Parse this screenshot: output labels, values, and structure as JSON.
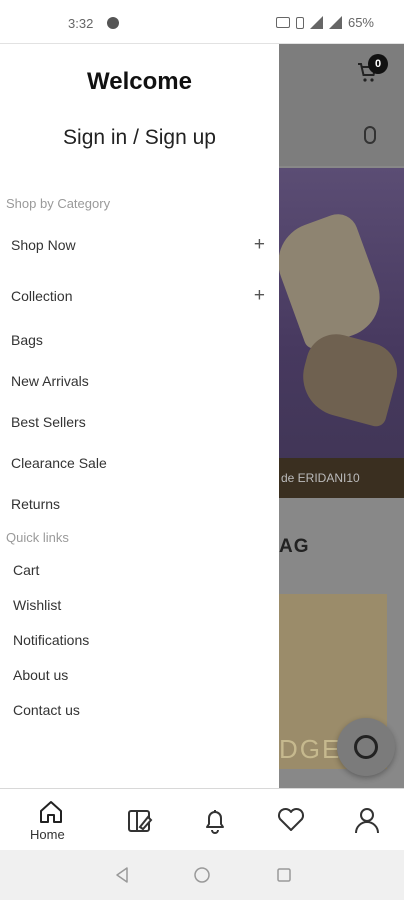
{
  "status_bar": {
    "time": "3:32",
    "battery": "65%"
  },
  "background_app": {
    "cart_count": "0",
    "hero_caption": "de ERIDANI10",
    "section_title": "AG",
    "product_text": "DGE"
  },
  "drawer": {
    "welcome": "Welcome",
    "signin": "Sign in / Sign up",
    "shop_section_label": "Shop by Category",
    "categories": [
      {
        "label": "Shop Now",
        "expandable": true
      },
      {
        "label": "Collection",
        "expandable": true
      },
      {
        "label": "Bags",
        "expandable": false
      },
      {
        "label": "New Arrivals",
        "expandable": false
      },
      {
        "label": "Best Sellers",
        "expandable": false
      },
      {
        "label": "Clearance Sale",
        "expandable": false
      },
      {
        "label": "Returns",
        "expandable": false
      }
    ],
    "expand_symbol": "+",
    "quick_section_label": "Quick links",
    "quick_links": [
      "Cart",
      "Wishlist",
      "Notifications",
      "About us",
      "Contact us"
    ]
  },
  "bottom_nav": {
    "home_label": "Home",
    "items": [
      "home-icon",
      "catalog-icon",
      "bell-icon",
      "heart-icon",
      "user-icon"
    ]
  },
  "system_nav": [
    "back-icon",
    "home-circle-icon",
    "recents-icon"
  ]
}
